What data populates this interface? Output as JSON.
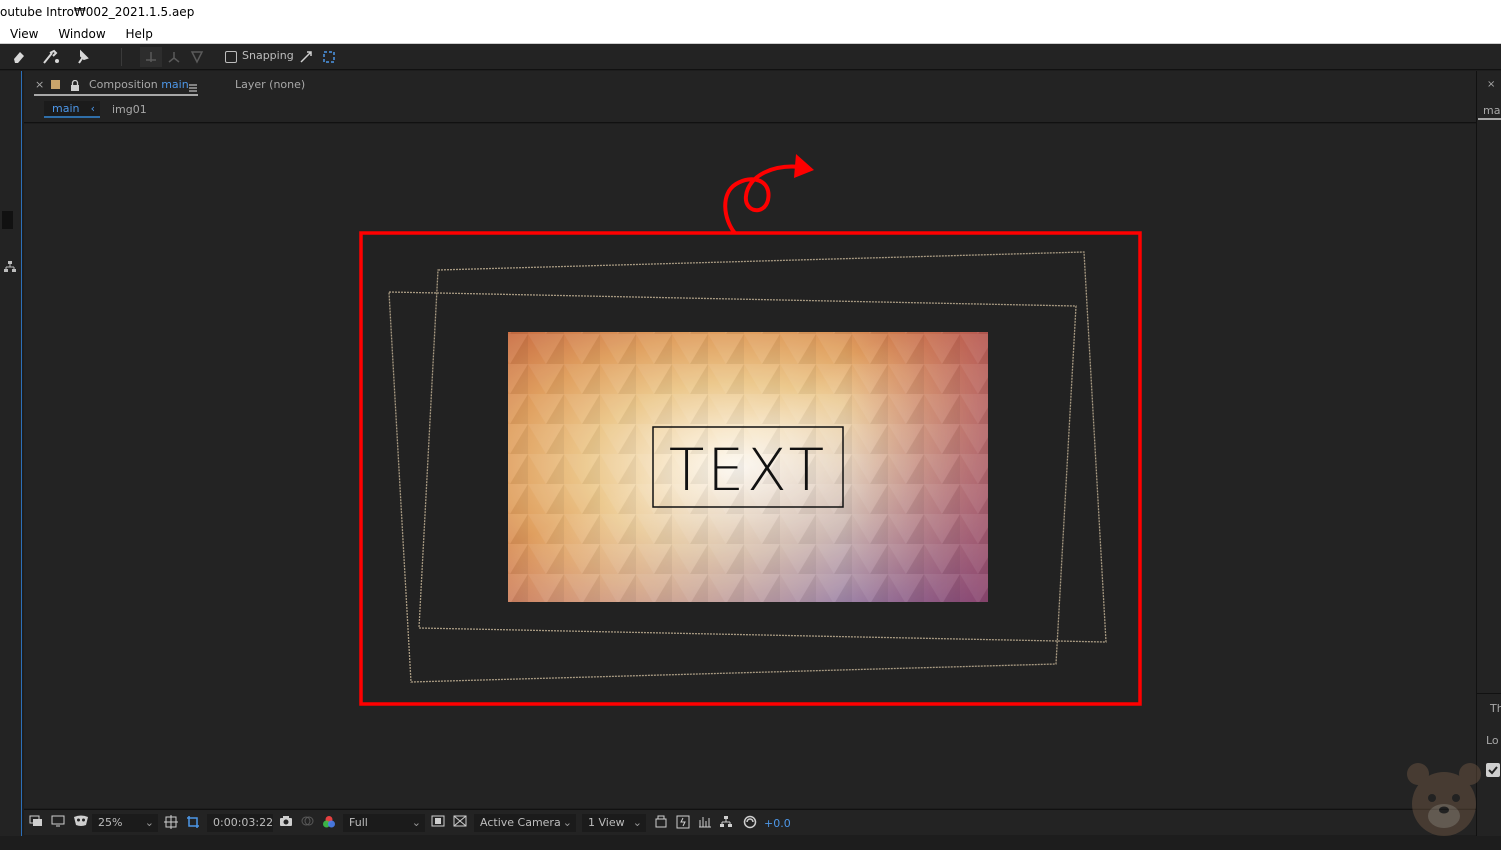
{
  "window": {
    "title": "outube Intro₩002_2021.1.5.aep"
  },
  "menu": {
    "items": [
      "View",
      "Window",
      "Help"
    ]
  },
  "toolbar": {
    "snapping_label": "Snapping"
  },
  "composition_panel": {
    "tab_label_prefix": "Composition",
    "tab_comp_name": "main",
    "layer_tab": "Layer (none)",
    "breadcrumb_main": "main",
    "breadcrumb_child": "img01"
  },
  "canvas": {
    "preview_text": "TEXT",
    "highlight_color": "#ff0000",
    "frame_color": "#a89a82"
  },
  "footer": {
    "zoom": "25%",
    "timecode": "0:00:03:22",
    "resolution": "Full",
    "camera": "Active Camera",
    "views": "1 View",
    "exposure": "+0.0"
  },
  "right_panel": {
    "fragments": [
      "ma",
      "Th",
      "Lo"
    ]
  }
}
